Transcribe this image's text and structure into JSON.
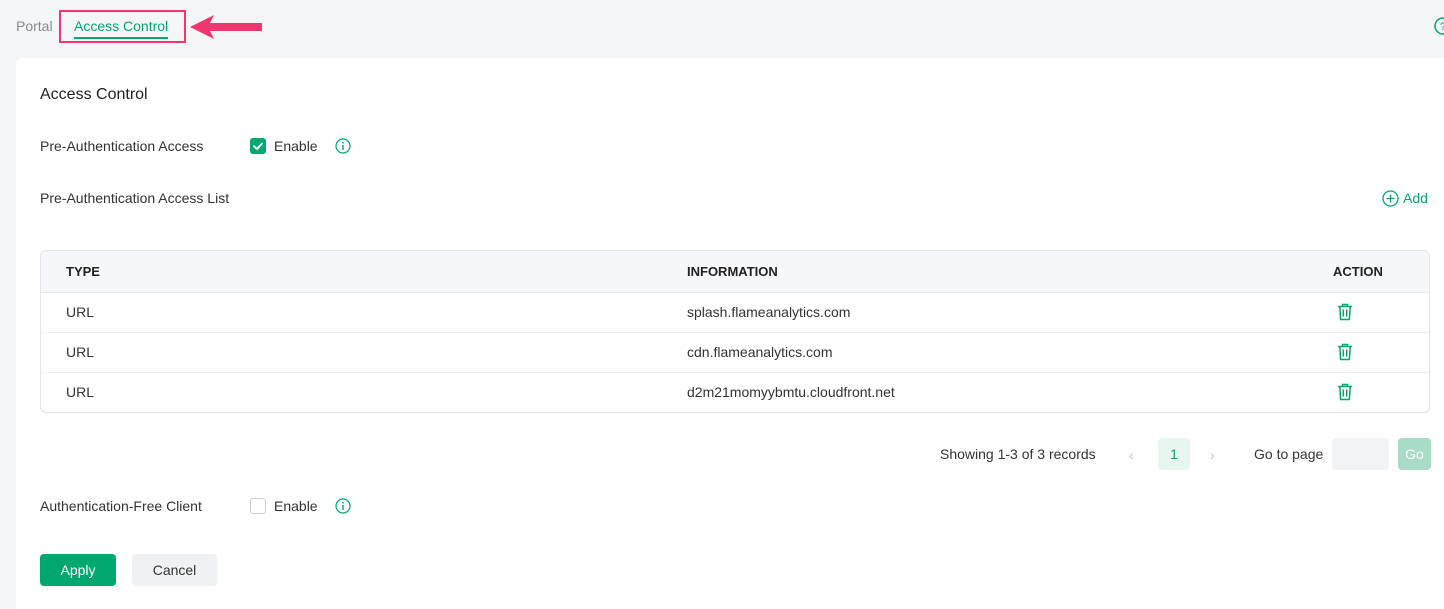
{
  "breadcrumb": {
    "items": [
      "Portal",
      "Access Control"
    ]
  },
  "section": {
    "title": "Access Control",
    "pre_auth_access": {
      "label": "Pre-Authentication Access",
      "checkbox_label": "Enable",
      "checked": true
    },
    "pre_auth_list": {
      "label": "Pre-Authentication Access List",
      "add_label": "Add"
    },
    "auth_free_client": {
      "label": "Authentication-Free Client",
      "checkbox_label": "Enable",
      "checked": false
    }
  },
  "table": {
    "columns": [
      "TYPE",
      "INFORMATION",
      "ACTION"
    ],
    "rows": [
      {
        "type": "URL",
        "information": "splash.flameanalytics.com"
      },
      {
        "type": "URL",
        "information": "cdn.flameanalytics.com"
      },
      {
        "type": "URL",
        "information": "d2m21momyybmtu.cloudfront.net"
      }
    ]
  },
  "pagination": {
    "summary": "Showing 1-3 of 3 records",
    "current_page": "1",
    "prev": "‹",
    "next": "›",
    "goto_label": "Go to page",
    "go_label": "Go"
  },
  "buttons": {
    "apply": "Apply",
    "cancel": "Cancel"
  },
  "icons": {
    "help": "help-circle-icon",
    "info": "info-icon",
    "add": "plus-circle-icon",
    "delete": "trash-icon",
    "annotation": "arrow-icon"
  },
  "colors": {
    "accent": "#00a870",
    "highlight": "#f0366e"
  }
}
